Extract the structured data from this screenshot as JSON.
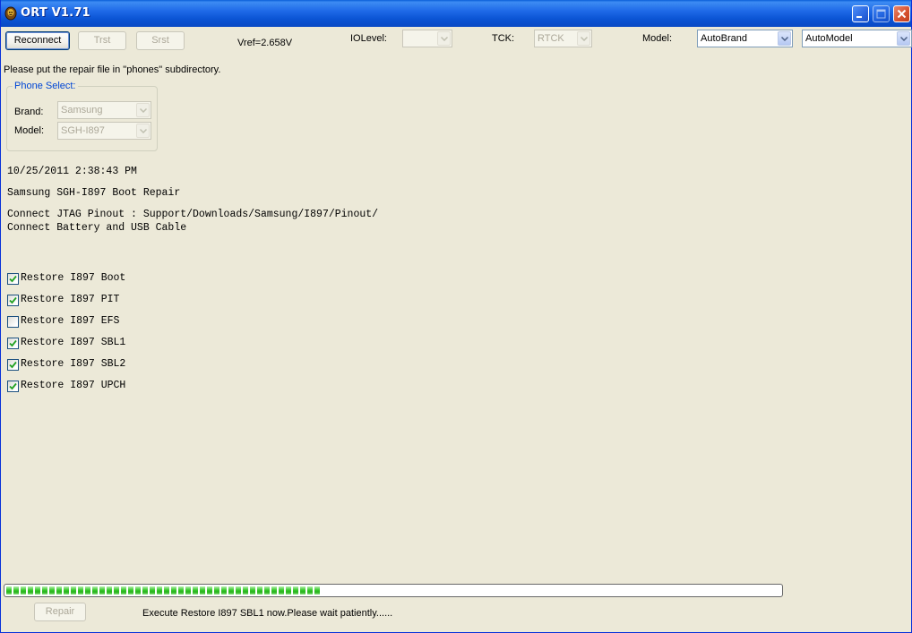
{
  "window": {
    "title": "ORT V1.71"
  },
  "toolbar": {
    "reconnect_label": "Reconnect",
    "trst_label": "Trst",
    "srst_label": "Srst",
    "vref": "Vref=2.658V",
    "iolevel_label": "IOLevel:",
    "iolevel_value": "",
    "tck_label": "TCK:",
    "tck_value": "RTCK",
    "model_label": "Model:",
    "brand_combo_value": "AutoBrand",
    "model_combo_value": "AutoModel"
  },
  "hint": "Please put the repair file in \"phones\" subdirectory.",
  "phone_select": {
    "title": "Phone Select:",
    "brand_label": "Brand:",
    "brand_value": "Samsung",
    "model_label": "Model:",
    "model_value": "SGH-I897"
  },
  "log": {
    "timestamp": "10/25/2011 2:38:43 PM",
    "repair_title": "Samsung SGH-I897 Boot Repair",
    "connect_jtag": "Connect JTAG Pinout : Support/Downloads/Samsung/I897/Pinout/",
    "connect_battery": "Connect Battery and USB Cable"
  },
  "options": [
    {
      "label": "Restore I897 Boot",
      "checked": true
    },
    {
      "label": "Restore I897 PIT",
      "checked": true
    },
    {
      "label": "Restore I897 EFS",
      "checked": false
    },
    {
      "label": "Restore I897 SBL1",
      "checked": true
    },
    {
      "label": "Restore I897 SBL2",
      "checked": true
    },
    {
      "label": "Restore I897 UPCH",
      "checked": true
    }
  ],
  "progress": {
    "fraction": 0.41,
    "color": "#2fbf22"
  },
  "footer": {
    "repair_label": "Repair",
    "status": "Execute Restore I897 SBL1 now.Please wait patiently......"
  }
}
